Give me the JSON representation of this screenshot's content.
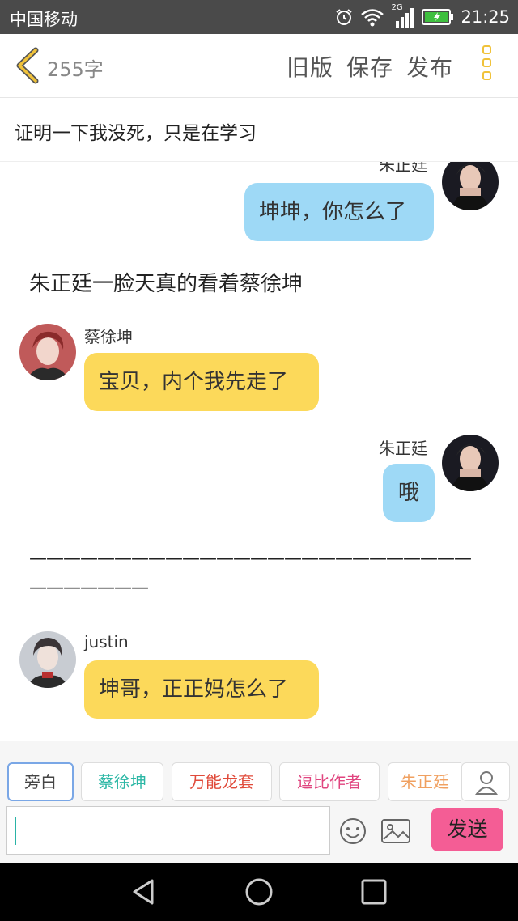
{
  "status": {
    "carrier": "中国移动",
    "network": "2G",
    "time": "21:25"
  },
  "header": {
    "word_count": "255字",
    "old_version": "旧版",
    "save": "保存",
    "publish": "发布"
  },
  "title": "证明一下我没死，只是在学习",
  "chat": {
    "m1": {
      "speaker": "朱正廷",
      "text": "坤坤，你怎么了"
    },
    "n1": "朱正廷一脸天真的看着蔡徐坤",
    "m2": {
      "speaker": "蔡徐坤",
      "text": "宝贝，内个我先走了"
    },
    "m3": {
      "speaker": "朱正廷",
      "text": "哦"
    },
    "n2a": "——————————————————————————",
    "n2b": "———————",
    "m4": {
      "speaker": "justin",
      "text": "坤哥，正正妈怎么了"
    }
  },
  "roles": [
    "旁白",
    "蔡徐坤",
    "万能龙套",
    "逗比作者",
    "朱正廷"
  ],
  "role_colors": [
    "#555555",
    "#2bb7a5",
    "#e04a3a",
    "#e0457f",
    "#f0a060"
  ],
  "send_label": "发送",
  "colors": {
    "accent": "#f0c23a",
    "blue_bubble": "#9ed9f6",
    "yellow_bubble": "#fcd95a",
    "send": "#f45d95"
  }
}
